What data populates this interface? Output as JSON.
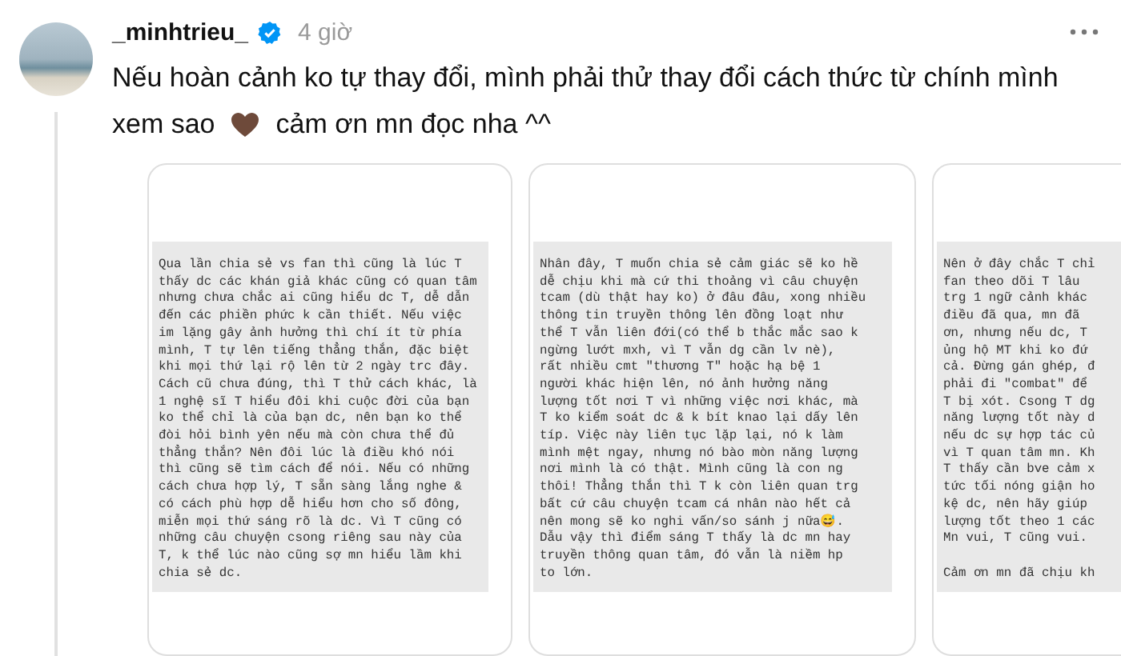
{
  "post": {
    "username": "_minhtrieu_",
    "time": "4 giờ",
    "first_line": "Nếu hoàn cảnh ko tự thay đổi, mình phải thử thay đổi cách thức từ chính mình",
    "text_before_heart": "xem sao",
    "text_after_heart": "cảm ơn mn đọc nha ^^"
  },
  "images": [
    {
      "paragraphs": [
        [
          "Qua lần chia sẻ vs fan thì cũng là lúc T",
          "thấy dc các khán giả khác cũng có quan tâm",
          "nhưng chưa chắc ai cũng hiểu dc T, dễ dẫn",
          "đến các phiền phức k cần thiết. Nếu việc",
          "im lặng gây ảnh hưởng thì chí ít từ phía",
          "mình, T tự lên tiếng thẳng thắn, đặc biệt",
          "khi mọi thứ lại rộ lên từ 2 ngày trc đây.",
          "Cách cũ chưa đúng, thì T thử cách khác, là",
          "1 nghệ sĩ T hiểu đôi khi cuộc đời của bạn",
          "ko thể chỉ là của bạn dc, nên bạn ko thể",
          "đòi hỏi bình yên nếu mà còn chưa thể đủ",
          "thẳng thắn? Nên đôi lúc là điều khó nói",
          "thì cũng sẽ tìm cách để nói. Nếu có những",
          "cách chưa hợp lý, T sẵn sàng lắng nghe &",
          "có cách phù hợp dễ hiểu hơn cho số đông,",
          "miễn mọi thứ sáng rõ là dc. Vì T cũng có",
          "những câu chuyện csong riêng sau này của",
          "T, k thể lúc nào cũng sợ mn hiểu lầm khi",
          "chia sẻ dc."
        ]
      ]
    },
    {
      "paragraphs": [
        [
          "Nhân đây, T muốn chia sẻ cảm giác sẽ ko hề",
          "dễ chịu khi mà cứ thi thoảng vì câu chuyện",
          "tcam (dù thật hay ko) ở đâu đâu, xong nhiều",
          "thông tin truyền thông lên đồng loạt như",
          "thể T vẫn liên đới(có thể b thắc mắc sao k",
          "ngừng lướt mxh, vì T vẫn dg cần lv nè),",
          "rất nhiều cmt \"thương T\" hoặc hạ bệ 1",
          "người khác hiện lên, nó ảnh hưởng năng",
          "lượng tốt nơi T vì những việc nơi khác, mà",
          "T ko kiểm soát dc & k bít knao lại dấy lên",
          "típ. Việc này liên tục lặp lại, nó k làm",
          "mình mệt ngay, nhưng nó bào mòn năng lượng",
          "nơi mình là có thật. Mình cũng là con ng",
          "thôi! Thẳng thắn thì T k còn liên quan trg",
          "bất cứ câu chuyện tcam cá nhân nào hết cả",
          "nên mong sẽ ko nghi vấn/so sánh j nữa😅.",
          "Dẫu vậy thì điểm sáng T thấy là dc mn hay",
          "truyền thông quan tâm, đó vẫn là niềm hp",
          "to lớn."
        ]
      ]
    },
    {
      "paragraphs": [
        [
          "Nên ở đây chắc T chỉ",
          "fan theo dõi T lâu",
          "trg 1 ngữ cảnh khác",
          "điều đã qua, mn đã",
          "ơn, nhưng nếu dc, T",
          "ủng hộ MT khi ko đứ",
          "cả. Đừng gán ghép, đ",
          "phải đi \"combat\" để",
          "T bị xót. Csong T dg",
          "năng lượng tốt này d",
          "nếu dc sự hợp tác củ",
          "vì T quan tâm mn. Kh",
          "T thấy cần bve cảm x",
          "tức tối nóng giận ho",
          "kệ dc, nên hãy giúp",
          "lượng tốt theo 1 các",
          "Mn vui, T cũng vui."
        ],
        [
          "Cảm ơn mn đã chịu kh"
        ]
      ]
    }
  ]
}
